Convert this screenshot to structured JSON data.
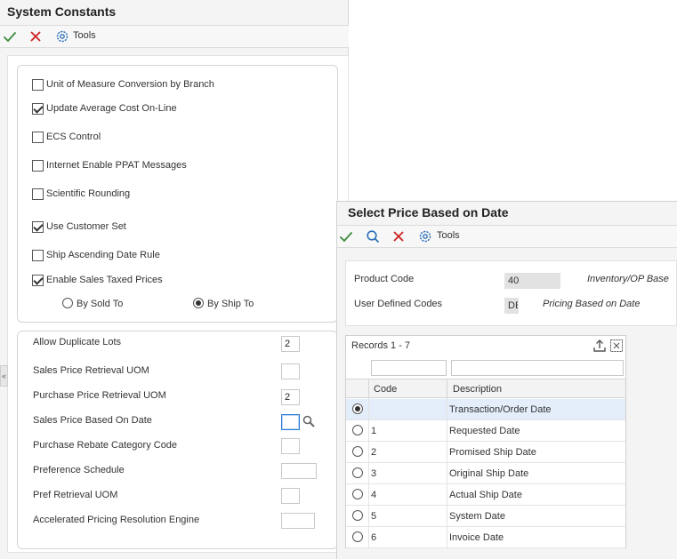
{
  "system_constants": {
    "title": "System Constants",
    "toolbar": {
      "tools_label": "Tools"
    },
    "checkboxes": [
      {
        "label": "Unit of Measure Conversion by Branch",
        "checked": false
      },
      {
        "label": "Update Average Cost On-Line",
        "checked": true
      },
      {
        "label": "ECS Control",
        "checked": false
      },
      {
        "label": "Internet Enable PPAT Messages",
        "checked": false
      },
      {
        "label": "Scientific Rounding",
        "checked": false
      },
      {
        "label": "Use Customer Set",
        "checked": true
      },
      {
        "label": "Ship Ascending Date Rule",
        "checked": false
      },
      {
        "label": "Enable Sales Taxed Prices",
        "checked": true
      }
    ],
    "radios": [
      {
        "label": "By Sold To",
        "selected": false
      },
      {
        "label": "By Ship To",
        "selected": true
      }
    ],
    "fields": [
      {
        "label": "Allow Duplicate Lots",
        "value": "2"
      },
      {
        "label": "Sales Price Retrieval UOM",
        "value": ""
      },
      {
        "label": "Purchase Price Retrieval UOM",
        "value": "2"
      },
      {
        "label": "Sales Price Based On Date",
        "value": ""
      },
      {
        "label": "Purchase Rebate Category Code",
        "value": ""
      },
      {
        "label": "Preference Schedule",
        "value": ""
      },
      {
        "label": "Pref Retrieval UOM",
        "value": ""
      },
      {
        "label": "Accelerated Pricing Resolution Engine",
        "value": ""
      }
    ]
  },
  "select_price": {
    "title": "Select Price Based on Date",
    "toolbar": {
      "tools_label": "Tools"
    },
    "header": {
      "product_code_label": "Product Code",
      "product_code_value": "40",
      "product_code_desc": "Inventory/OP Base",
      "udc_label": "User Defined Codes",
      "udc_value": "DE",
      "udc_desc": "Pricing Based on Date"
    },
    "grid": {
      "records_label": "Records 1 - 7",
      "columns": [
        "Code",
        "Description"
      ],
      "rows": [
        {
          "code": "",
          "description": "Transaction/Order Date",
          "selected": true
        },
        {
          "code": "1",
          "description": "Requested Date",
          "selected": false
        },
        {
          "code": "2",
          "description": "Promised Ship Date",
          "selected": false
        },
        {
          "code": "3",
          "description": "Original Ship Date",
          "selected": false
        },
        {
          "code": "4",
          "description": "Actual Ship Date",
          "selected": false
        },
        {
          "code": "5",
          "description": "System Date",
          "selected": false
        },
        {
          "code": "6",
          "description": "Invoice Date",
          "selected": false
        }
      ]
    }
  },
  "colors": {
    "ok_green": "#3a8a3a",
    "cancel_red": "#cc2222",
    "tools_blue": "#2a6fb8"
  },
  "icons": [
    "checkmark-icon",
    "close-icon",
    "gear-icon",
    "search-icon",
    "export-icon",
    "fullscreen-icon",
    "collapse-icon"
  ]
}
